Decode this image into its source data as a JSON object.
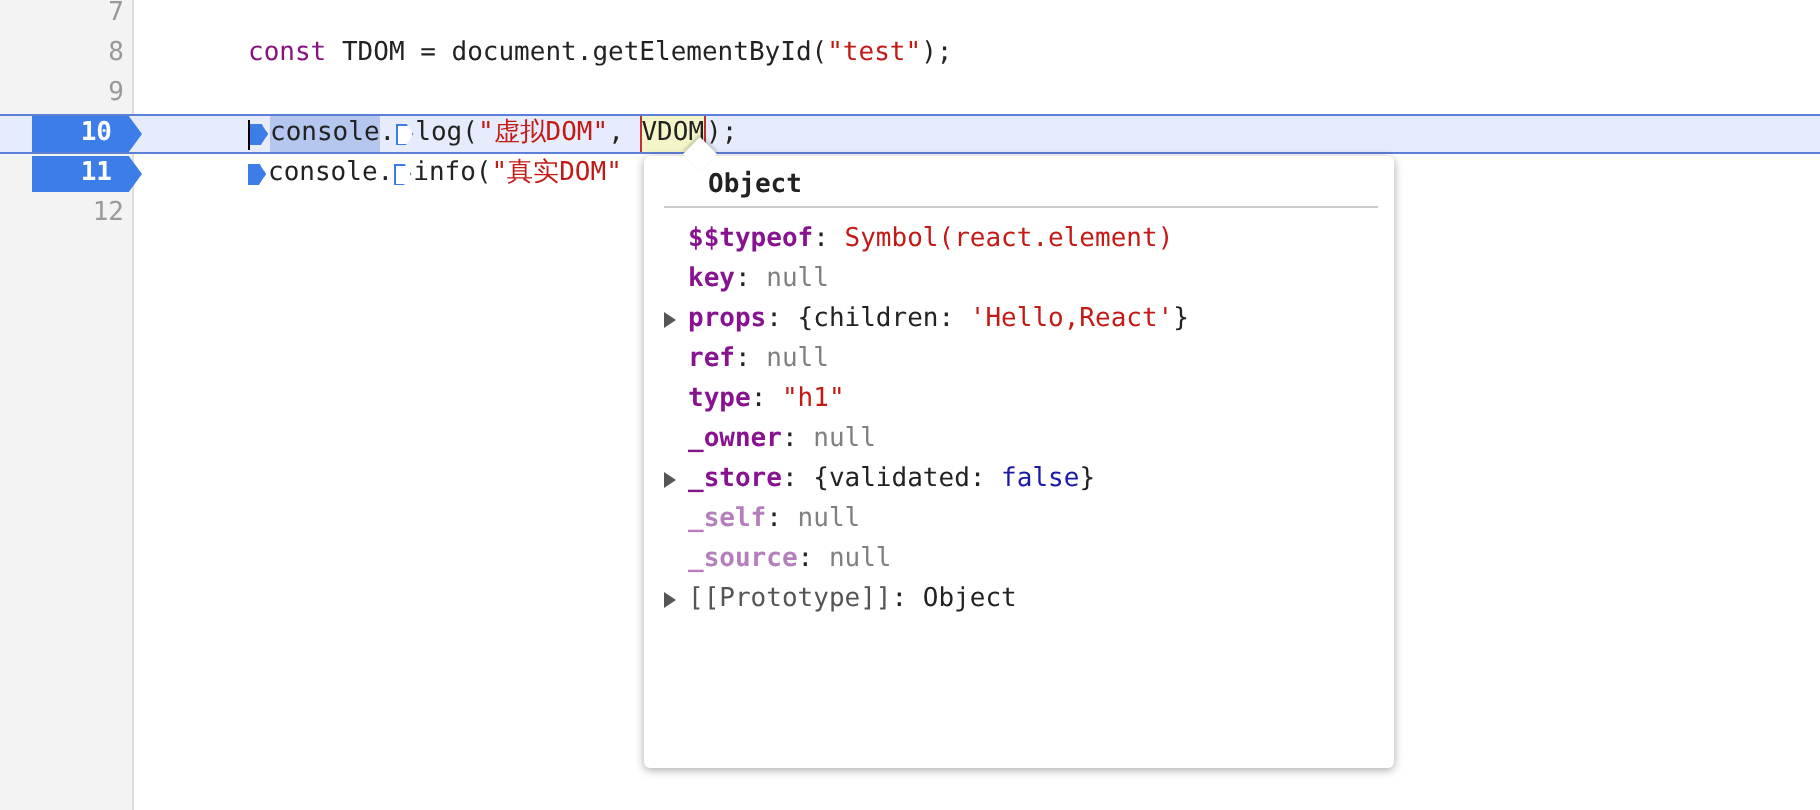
{
  "editor": {
    "lines": [
      {
        "number": "7",
        "breakpoint": false,
        "current": false
      },
      {
        "number": "8",
        "breakpoint": false,
        "current": false,
        "tokens": [
          {
            "kind": "keyword",
            "text": "const"
          },
          {
            "kind": "plain",
            "text": " TDOM = document.getElementById("
          },
          {
            "kind": "string",
            "text": "\"test\""
          },
          {
            "kind": "plain",
            "text": ");"
          }
        ]
      },
      {
        "number": "9",
        "breakpoint": false,
        "current": false
      },
      {
        "number": "10",
        "breakpoint": true,
        "current": true,
        "tokens": [
          {
            "kind": "caret"
          },
          {
            "kind": "marker",
            "active": true
          },
          {
            "kind": "selected",
            "text": "console"
          },
          {
            "kind": "plain",
            "text": "."
          },
          {
            "kind": "marker",
            "active": false
          },
          {
            "kind": "plain",
            "text": "log("
          },
          {
            "kind": "string",
            "text": "\"虚拟DOM\""
          },
          {
            "kind": "plain",
            "text": ", "
          },
          {
            "kind": "hover",
            "text": "VDOM"
          },
          {
            "kind": "plain",
            "text": ");"
          }
        ]
      },
      {
        "number": "11",
        "breakpoint": true,
        "current": false,
        "tokens": [
          {
            "kind": "marker",
            "active": true
          },
          {
            "kind": "plain",
            "text": "console."
          },
          {
            "kind": "marker",
            "active": false
          },
          {
            "kind": "plain",
            "text": "info("
          },
          {
            "kind": "string",
            "text": "\"真实DOM\""
          }
        ]
      },
      {
        "number": "12",
        "breakpoint": false,
        "current": false
      }
    ]
  },
  "popover": {
    "title": "Object",
    "properties": [
      {
        "kind": "own",
        "expandable": false,
        "key": "$$typeof",
        "value": [
          {
            "kind": "plain",
            "text": ": "
          },
          {
            "kind": "string",
            "text": "Symbol(react.element)"
          }
        ]
      },
      {
        "kind": "own",
        "expandable": false,
        "key": "key",
        "value": [
          {
            "kind": "plain",
            "text": ": "
          },
          {
            "kind": "null",
            "text": "null"
          }
        ]
      },
      {
        "kind": "own",
        "expandable": true,
        "key": "props",
        "value": [
          {
            "kind": "plain",
            "text": ": "
          },
          {
            "kind": "plain",
            "text": "{children: "
          },
          {
            "kind": "string",
            "text": "'Hello,React'"
          },
          {
            "kind": "plain",
            "text": "}"
          }
        ]
      },
      {
        "kind": "own",
        "expandable": false,
        "key": "ref",
        "value": [
          {
            "kind": "plain",
            "text": ": "
          },
          {
            "kind": "null",
            "text": "null"
          }
        ]
      },
      {
        "kind": "own",
        "expandable": false,
        "key": "type",
        "value": [
          {
            "kind": "plain",
            "text": ": "
          },
          {
            "kind": "string",
            "text": "\"h1\""
          }
        ]
      },
      {
        "kind": "own",
        "expandable": false,
        "key": "_owner",
        "value": [
          {
            "kind": "plain",
            "text": ": "
          },
          {
            "kind": "null",
            "text": "null"
          }
        ]
      },
      {
        "kind": "own",
        "expandable": true,
        "key": "_store",
        "value": [
          {
            "kind": "plain",
            "text": ": "
          },
          {
            "kind": "plain",
            "text": "{validated: "
          },
          {
            "kind": "bool",
            "text": "false"
          },
          {
            "kind": "plain",
            "text": "}"
          }
        ]
      },
      {
        "kind": "faded",
        "expandable": false,
        "key": "_self",
        "value": [
          {
            "kind": "plain",
            "text": ": "
          },
          {
            "kind": "null",
            "text": "null"
          }
        ]
      },
      {
        "kind": "faded",
        "expandable": false,
        "key": "_source",
        "value": [
          {
            "kind": "plain",
            "text": ": "
          },
          {
            "kind": "null",
            "text": "null"
          }
        ]
      },
      {
        "kind": "internal",
        "expandable": true,
        "key": "[[Prototype]]",
        "value": [
          {
            "kind": "plain",
            "text": ": "
          },
          {
            "kind": "plain",
            "text": "Object"
          }
        ]
      }
    ]
  }
}
